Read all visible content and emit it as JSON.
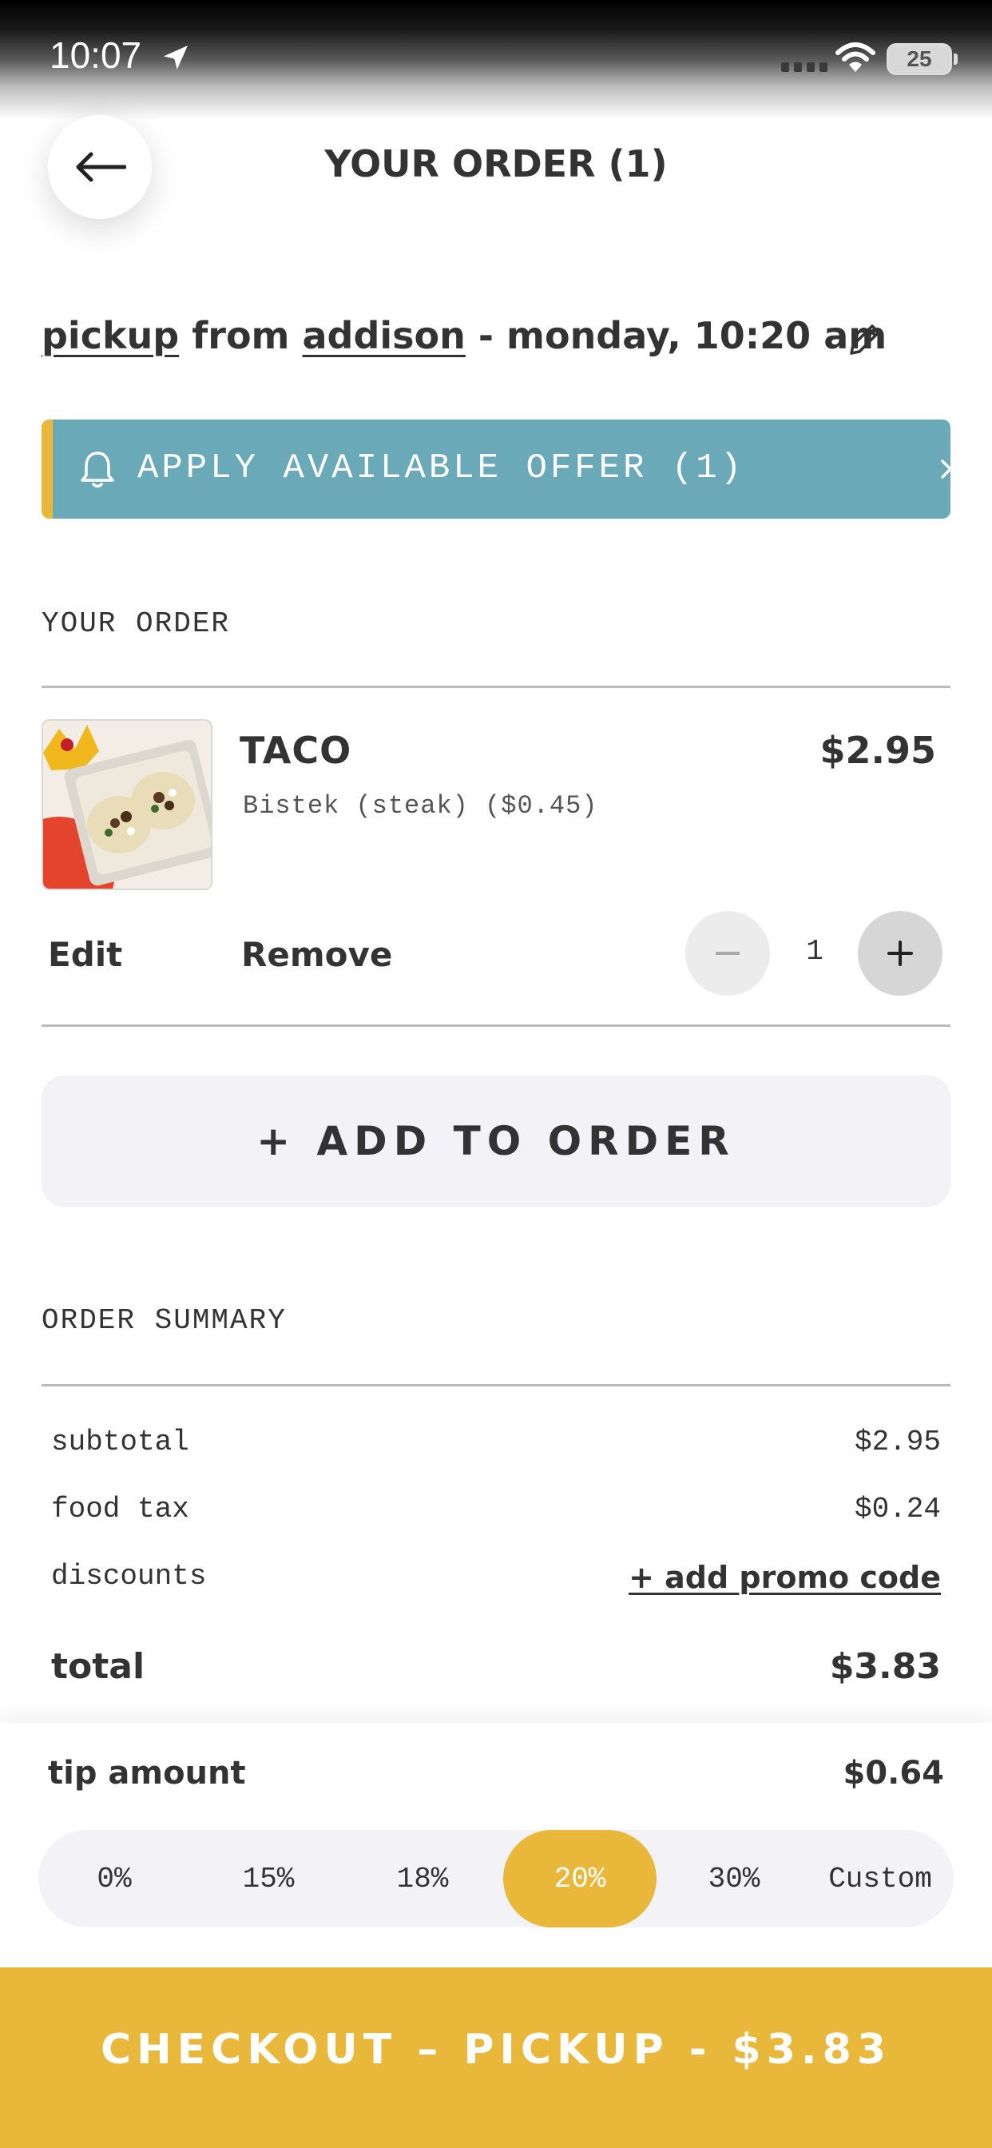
{
  "status_bar": {
    "time": "10:07",
    "battery": "25"
  },
  "header": {
    "title": "YOUR ORDER (1)"
  },
  "pickup": {
    "mode": "pickup",
    "from_word": "from",
    "location": "addison",
    "time_text": "- monday, 10:20 am"
  },
  "offer_banner": {
    "label": "APPLY AVAILABLE OFFER (1)",
    "accent_color": "#e9b83a",
    "bg_color": "#6aaab8"
  },
  "order_section": {
    "label": "YOUR ORDER",
    "items": [
      {
        "name": "TACO",
        "price": "$2.95",
        "modifier": "Bistek (steak) ($0.45)",
        "quantity": "1",
        "edit_label": "Edit",
        "remove_label": "Remove"
      }
    ],
    "add_button": "+ ADD TO ORDER"
  },
  "summary": {
    "label": "ORDER SUMMARY",
    "subtotal_label": "subtotal",
    "subtotal": "$2.95",
    "tax_label": "food tax",
    "tax": "$0.24",
    "discounts_label": "discounts",
    "promo_link": "+ add promo code",
    "total_label": "total",
    "total": "$3.83"
  },
  "tip": {
    "label": "tip amount",
    "amount": "$0.64",
    "options": [
      "0%",
      "15%",
      "18%",
      "20%",
      "30%",
      "Custom"
    ],
    "selected": "20%"
  },
  "checkout": {
    "label": "CHECKOUT – PICKUP - $3.83",
    "color": "#e9b83a"
  },
  "icons": [
    "back-arrow-icon",
    "location-arrow-icon",
    "wifi-icon",
    "battery-icon",
    "pencil-icon",
    "bell-icon",
    "chevron-right-icon",
    "minus-icon",
    "plus-icon"
  ]
}
